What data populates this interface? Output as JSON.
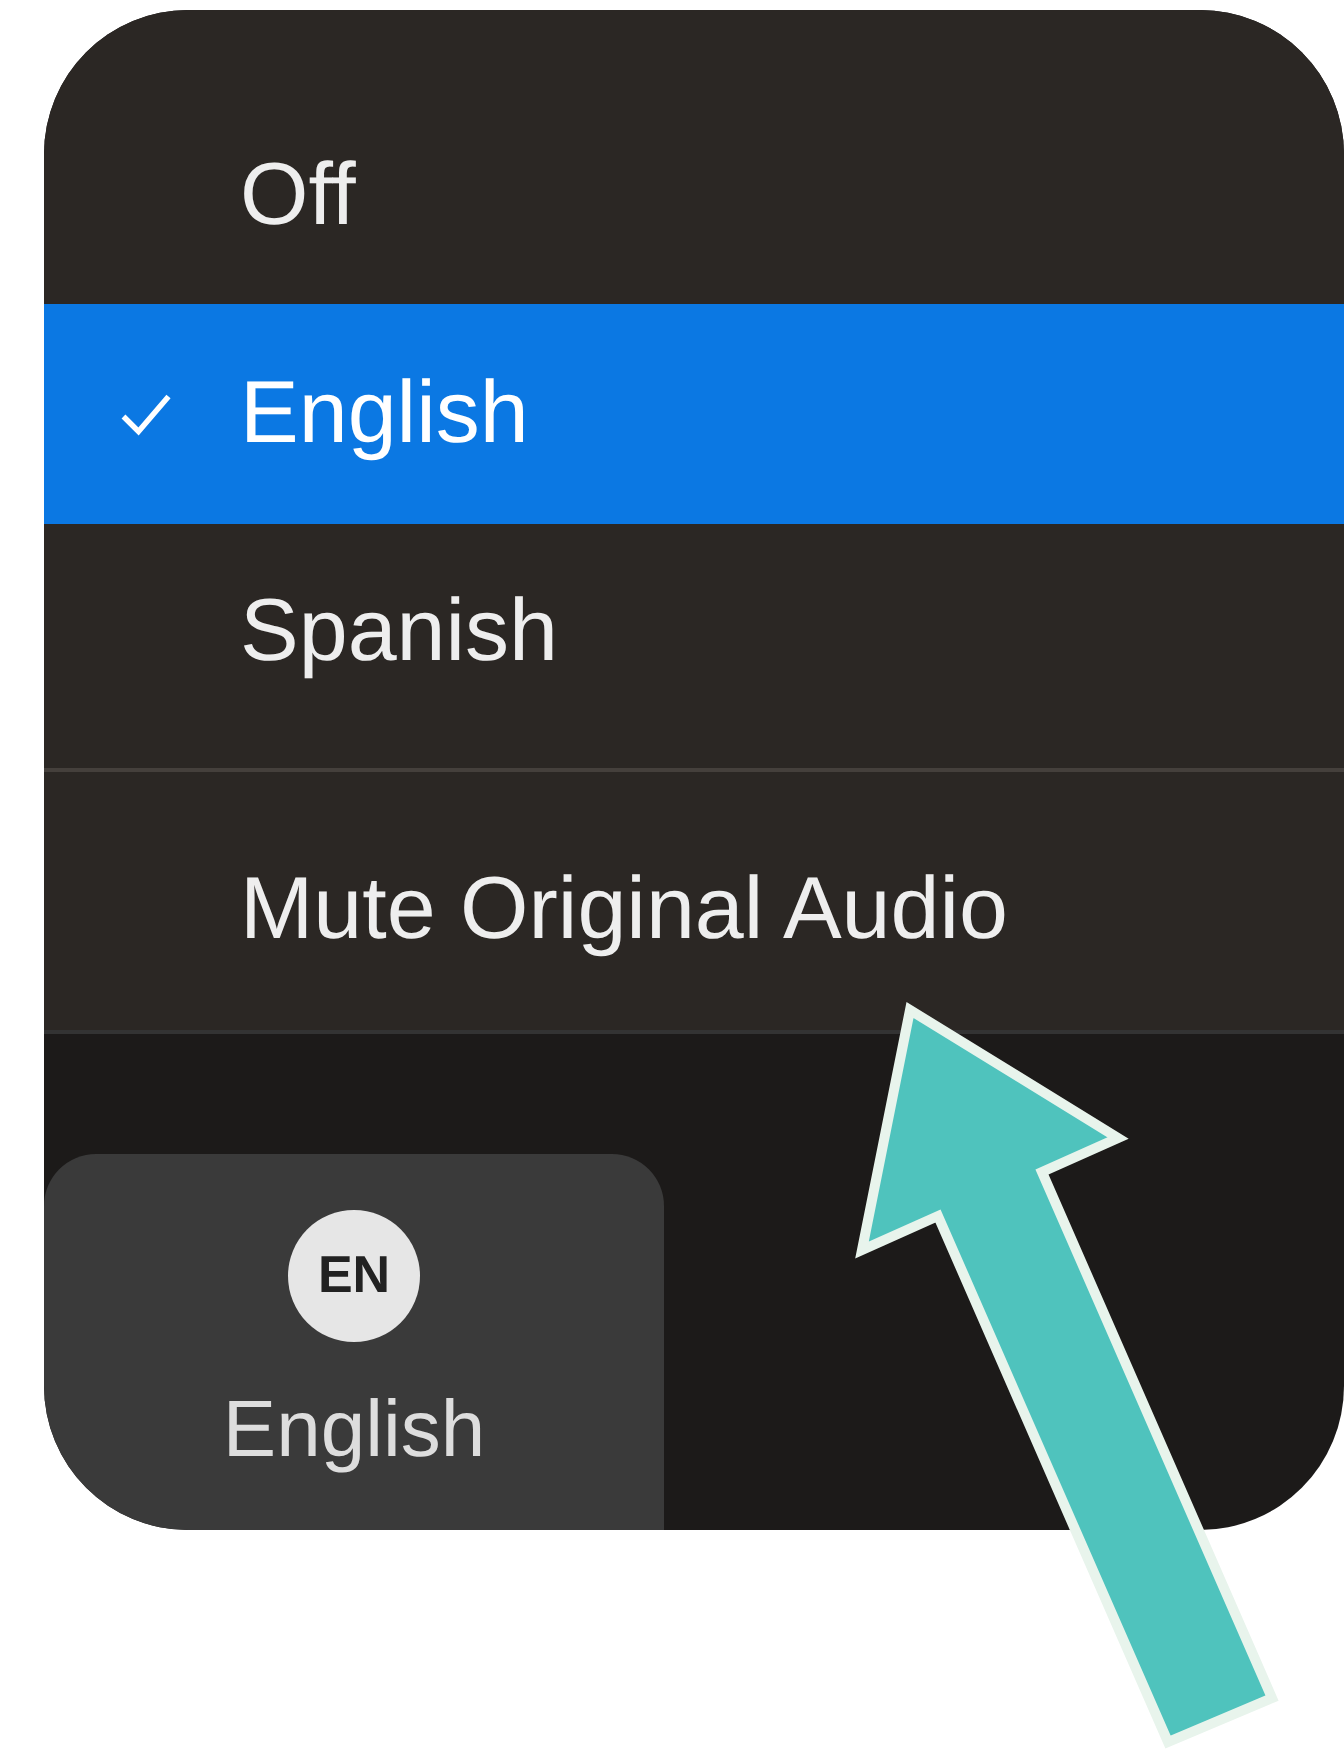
{
  "menu": {
    "items": [
      {
        "kind": "option",
        "label": "Off",
        "selected": false
      },
      {
        "kind": "option",
        "label": "English",
        "selected": true
      },
      {
        "kind": "option",
        "label": "Spanish",
        "selected": false
      },
      {
        "kind": "divider"
      },
      {
        "kind": "action",
        "label": "Mute Original Audio"
      }
    ]
  },
  "toolbar": {
    "button": {
      "badge": "EN",
      "label": "English"
    }
  }
}
